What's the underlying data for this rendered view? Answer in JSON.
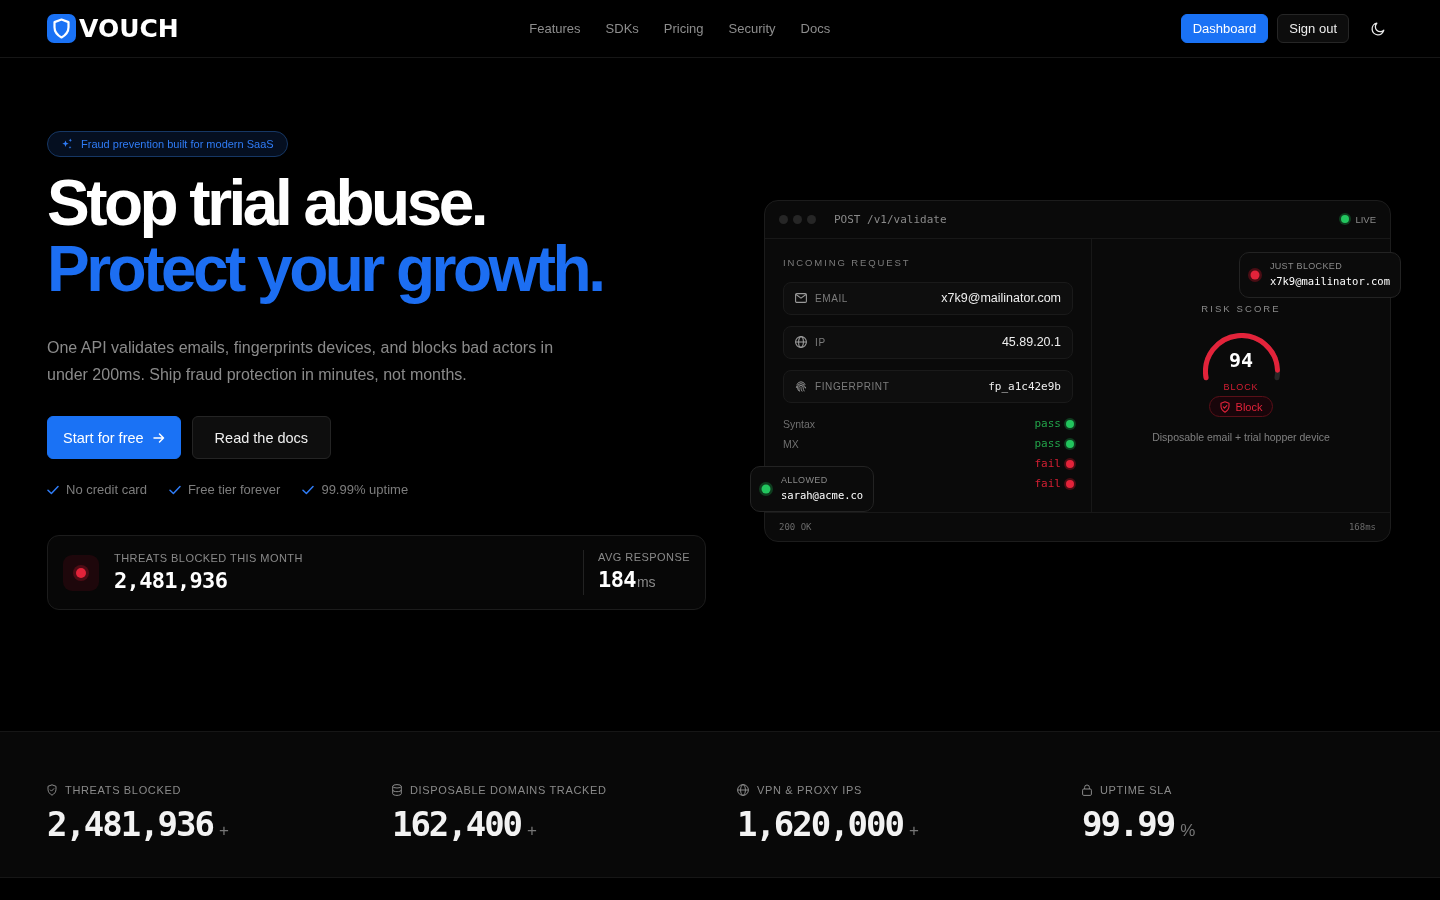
{
  "header": {
    "logo": "VOUCH",
    "nav": [
      {
        "label": "Features"
      },
      {
        "label": "SDKs"
      },
      {
        "label": "Pricing"
      },
      {
        "label": "Security"
      },
      {
        "label": "Docs"
      }
    ],
    "actions": [
      {
        "label": "Dashboard",
        "kind": "primary"
      },
      {
        "label": "Sign out",
        "kind": "secondary"
      }
    ]
  },
  "hero": {
    "badge": "Fraud prevention built for modern SaaS",
    "headline": [
      {
        "text": "Stop trial abuse.",
        "kind": "plain"
      },
      {
        "text": "Protect your growth.",
        "kind": "accent"
      }
    ],
    "description": "One API validates emails, fingerprints devices, and blocks bad actors in under 200ms. Ship fraud protection in minutes, not months.",
    "buttons": [
      {
        "label": "Start for free",
        "kind": "primary"
      },
      {
        "label": "Read the docs",
        "kind": "secondary"
      }
    ],
    "perks": [
      "No credit card",
      "Free tier forever",
      "99.99% uptime"
    ],
    "stats_card": {
      "label": "THREATS BLOCKED THIS MONTH",
      "value": "2,481,936",
      "side_label": "AVG RESPONSE",
      "side_value": "184",
      "side_unit": "ms"
    }
  },
  "demo": {
    "endpoint": "POST /v1/validate",
    "live": "LIVE",
    "section_title": "INCOMING REQUEST",
    "fields": [
      {
        "label": "EMAIL",
        "value": "x7k9@mailinator.com",
        "kind": "email"
      },
      {
        "label": "IP",
        "value": "45.89.20.1",
        "kind": "ip"
      },
      {
        "label": "FINGERPRINT",
        "value": "fp_a1c42e9b",
        "kind": "fingerprint"
      }
    ],
    "checks": [
      {
        "label": "Syntax",
        "result": "pass",
        "passed": true
      },
      {
        "label": "MX",
        "result": "pass",
        "passed": true
      },
      {
        "result": "fail",
        "passed": false
      },
      {
        "result": "fail",
        "passed": false
      }
    ],
    "risk": {
      "title": "RISK SCORE",
      "score": "94",
      "level": 0.94,
      "verdict": "BLOCK",
      "action": "Block",
      "reason": "Disposable email + trial hopper device"
    },
    "status": "200 OK",
    "latency": "168ms",
    "toasts": [
      {
        "kind": "allowed",
        "label": "ALLOWED",
        "email": "sarah@acme.co"
      },
      {
        "kind": "blocked",
        "label": "JUST BLOCKED",
        "email": "x7k9@mailinator.com"
      }
    ]
  },
  "metrics": [
    {
      "kind": "shield",
      "label": "THREATS BLOCKED",
      "value": "2,481,936",
      "suffix": "+"
    },
    {
      "kind": "database",
      "label": "DISPOSABLE DOMAINS TRACKED",
      "value": "162,400",
      "suffix": "+"
    },
    {
      "kind": "globe",
      "label": "VPN & PROXY IPS",
      "value": "1,620,000",
      "suffix": "+"
    },
    {
      "kind": "lock",
      "label": "UPTIME SLA",
      "value": "99.99",
      "suffix": "%"
    }
  ]
}
